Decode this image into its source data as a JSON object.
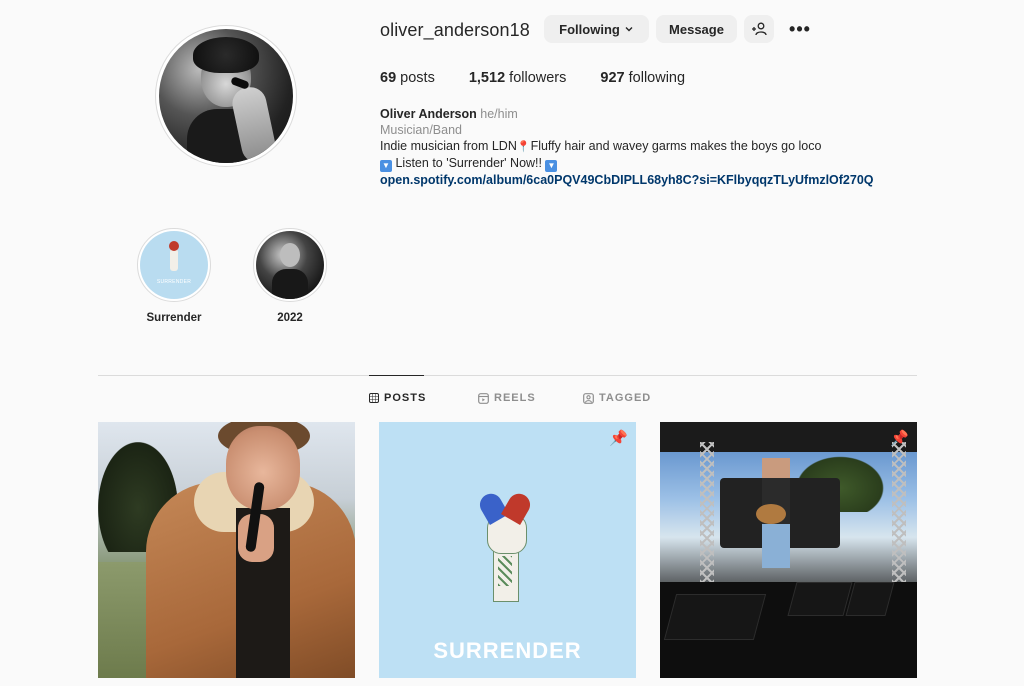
{
  "profile": {
    "username": "oliver_anderson18",
    "following_button": "Following",
    "message_button": "Message",
    "more_icon": "•••",
    "stats": {
      "posts_count": "69",
      "posts_label": "posts",
      "followers_count": "1,512",
      "followers_label": "followers",
      "following_count": "927",
      "following_label": "following"
    },
    "bio": {
      "name": "Oliver Anderson",
      "pronouns": "he/him",
      "category": "Musician/Band",
      "line1_pre": "Indie musician from LDN",
      "line1_post": "Fluffy hair and wavey garms makes the boys go loco",
      "line2": "Listen to 'Surrender' Now!!",
      "link": "open.spotify.com/album/6ca0PQV49CbDIPLL68yh8C?si=KFlbyqqzTLyUfmzlOf270Q"
    }
  },
  "highlights": [
    {
      "label": "Surrender",
      "cover_text": "SURRENDER"
    },
    {
      "label": "2022"
    }
  ],
  "tabs": {
    "posts": "POSTS",
    "reels": "REELS",
    "tagged": "TAGGED"
  },
  "posts": [
    {
      "pinned": false
    },
    {
      "pinned": true,
      "overlay_text": "SURRENDER"
    },
    {
      "pinned": true
    }
  ],
  "icons": {
    "chevron": "chevron-down-icon",
    "add_user": "add-user-icon",
    "pin": "pushpin-icon",
    "location_pin": "round-pushpin-icon",
    "download": "down-arrow-button-icon"
  },
  "colors": {
    "background": "#fafafa",
    "button_bg": "#efefef",
    "link": "#00376b",
    "muted": "#8e8e8e",
    "text": "#262626"
  }
}
